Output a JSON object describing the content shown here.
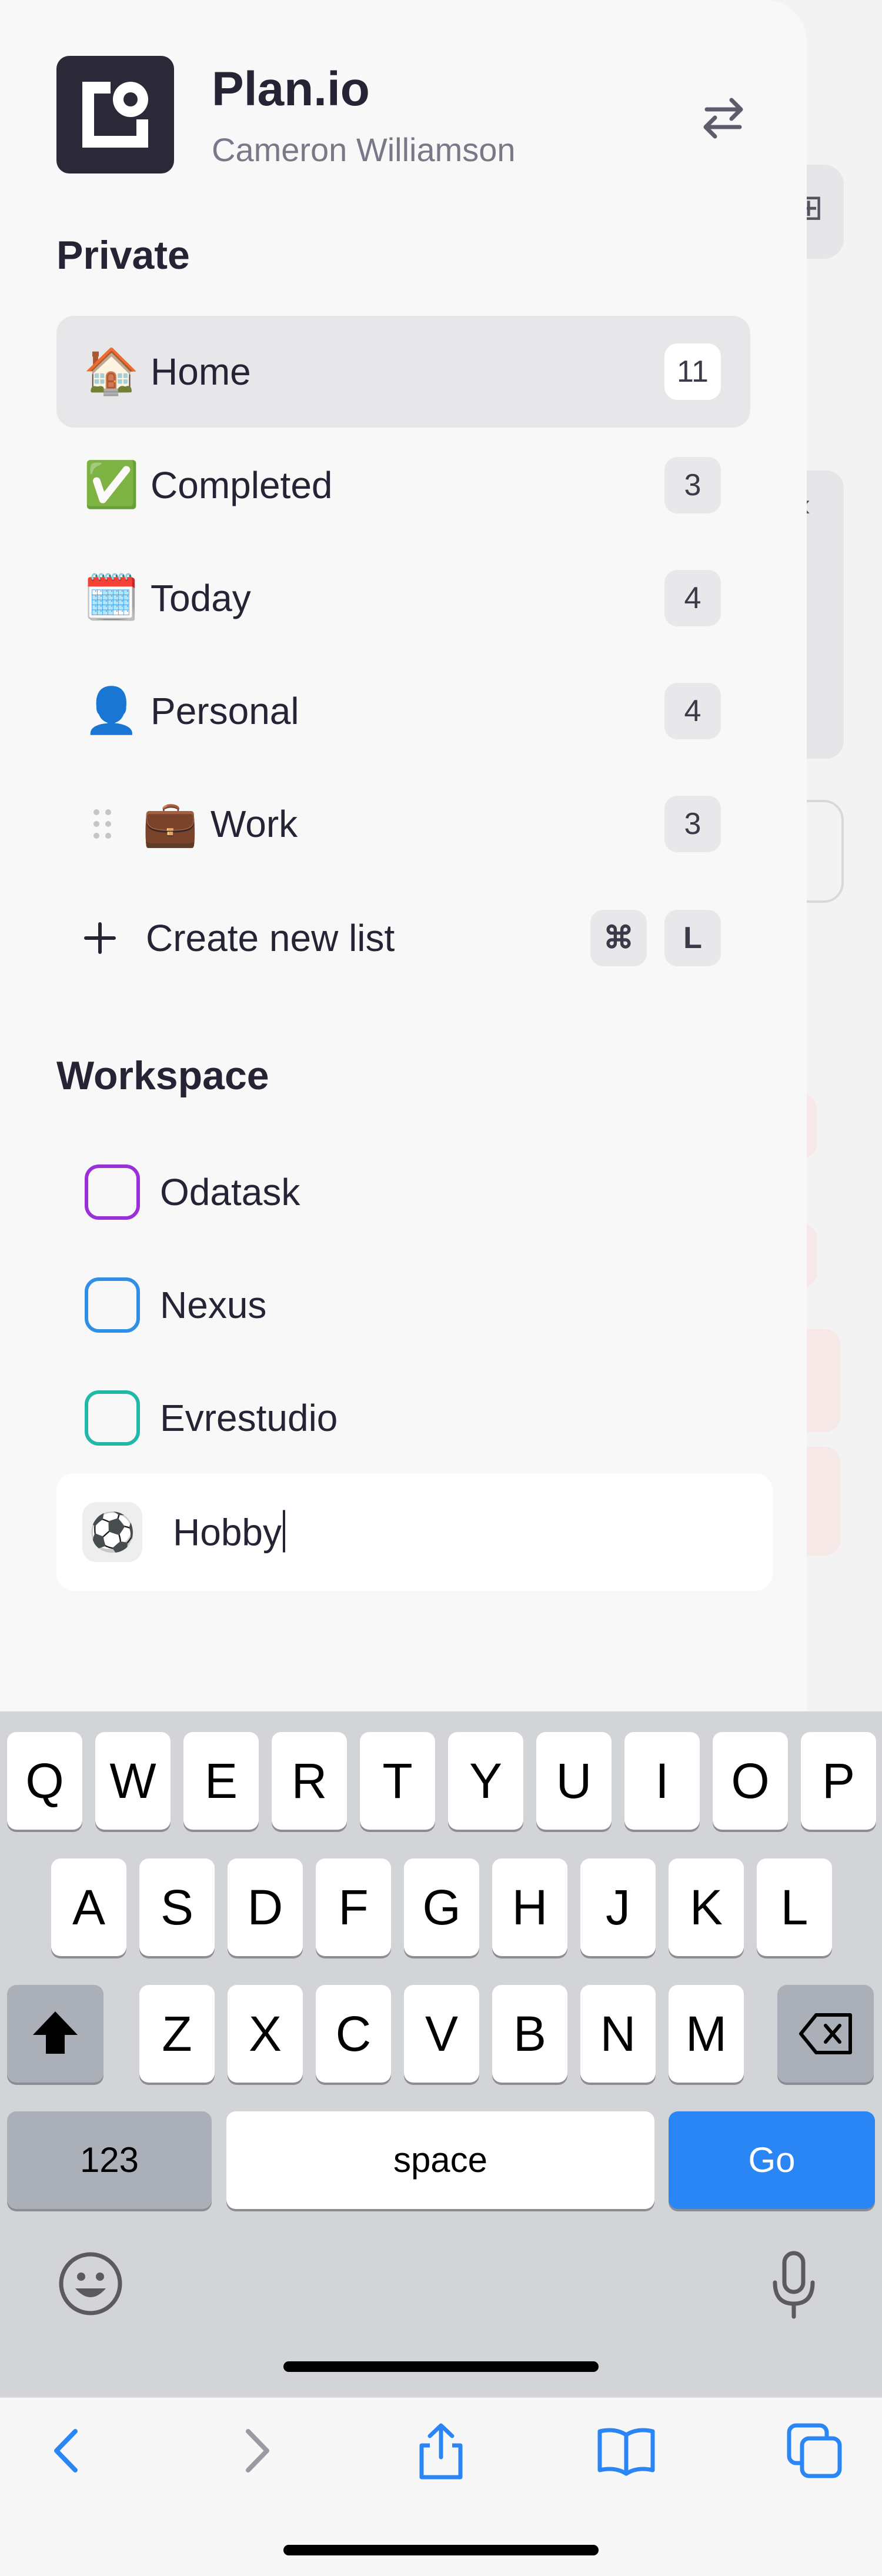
{
  "app": {
    "name": "Plan.io",
    "user": "Cameron Williamson"
  },
  "private": {
    "title": "Private",
    "items": [
      {
        "emoji": "🏠",
        "label": "Home",
        "count": "11"
      },
      {
        "emoji": "✅",
        "label": "Completed",
        "count": "3"
      },
      {
        "emoji": "🗓️",
        "label": "Today",
        "count": "4"
      },
      {
        "emoji": "👤",
        "label": "Personal",
        "count": "4"
      },
      {
        "emoji": "💼",
        "label": "Work",
        "count": "3"
      }
    ],
    "create_label": "Create new list",
    "shortcut_mod": "⌘",
    "shortcut_key": "L"
  },
  "workspace": {
    "title": "Workspace",
    "items": [
      {
        "label": "Odatask",
        "color": "#9b30d9"
      },
      {
        "label": "Nexus",
        "color": "#2f8fe6"
      },
      {
        "label": "Evrestudio",
        "color": "#20b8a8"
      }
    ]
  },
  "new_list_input": {
    "emoji": "⚽",
    "value": "Hobby"
  },
  "keyboard": {
    "row1": [
      "Q",
      "W",
      "E",
      "R",
      "T",
      "Y",
      "U",
      "I",
      "O",
      "P"
    ],
    "row2": [
      "A",
      "S",
      "D",
      "F",
      "G",
      "H",
      "J",
      "K",
      "L"
    ],
    "row3": [
      "Z",
      "X",
      "C",
      "V",
      "B",
      "N",
      "M"
    ],
    "numbers_label": "123",
    "space_label": "space",
    "go_label": "Go"
  },
  "icons": {
    "switch": "switch-arrows-icon",
    "shift": "shift-icon",
    "delete": "backspace-icon",
    "emoji": "emoji-icon",
    "mic": "microphone-icon",
    "back": "chevron-left-icon",
    "forward": "chevron-right-icon",
    "share": "share-icon",
    "bookmarks": "book-icon",
    "tabs": "tabs-icon"
  },
  "colors": {
    "accent_blue": "#2a86f5",
    "logo_bg": "#2b2838"
  }
}
